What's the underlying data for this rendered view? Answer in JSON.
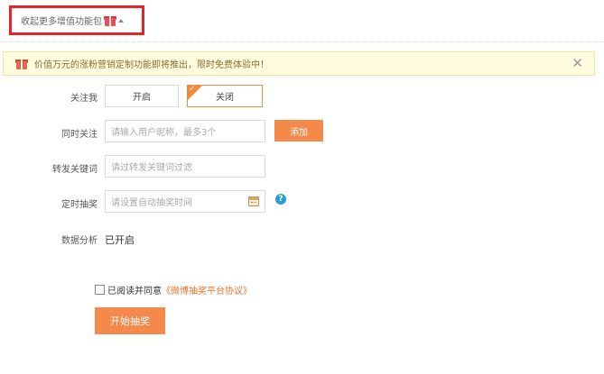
{
  "header": {
    "collapse_label": "收起更多增值功能包",
    "gift_icon": "gift-icon",
    "caret_icon": "caret-up-icon"
  },
  "notice": {
    "text": "价值万元的涨粉营销定制功能即将推出，限时免费体验中！",
    "close_label": "✕",
    "icon": "gift-icon"
  },
  "form": {
    "follow": {
      "label": "关注我",
      "option_on": "开启",
      "option_off": "关闭",
      "selected": "关闭"
    },
    "mention": {
      "label": "同时关注",
      "placeholder": "请输入用户昵称，最多3个",
      "add_label": "添加"
    },
    "keyword": {
      "label": "转发关键词",
      "placeholder": "请过转发关键词过滤"
    },
    "timer": {
      "label": "定时抽奖",
      "placeholder": "请设置自动抽奖时间",
      "help_label": "?"
    },
    "analysis": {
      "label": "数据分析",
      "value": "已开启"
    }
  },
  "agreement": {
    "text": "已阅读并同意",
    "link": "《微博抽奖平台协议》",
    "checked": false
  },
  "submit_label": "开始抽奖",
  "colors": {
    "accent": "#f5894a",
    "highlight_border": "#e5232c",
    "notice_bg": "#fffce0",
    "help_blue": "#2f9bd8"
  }
}
